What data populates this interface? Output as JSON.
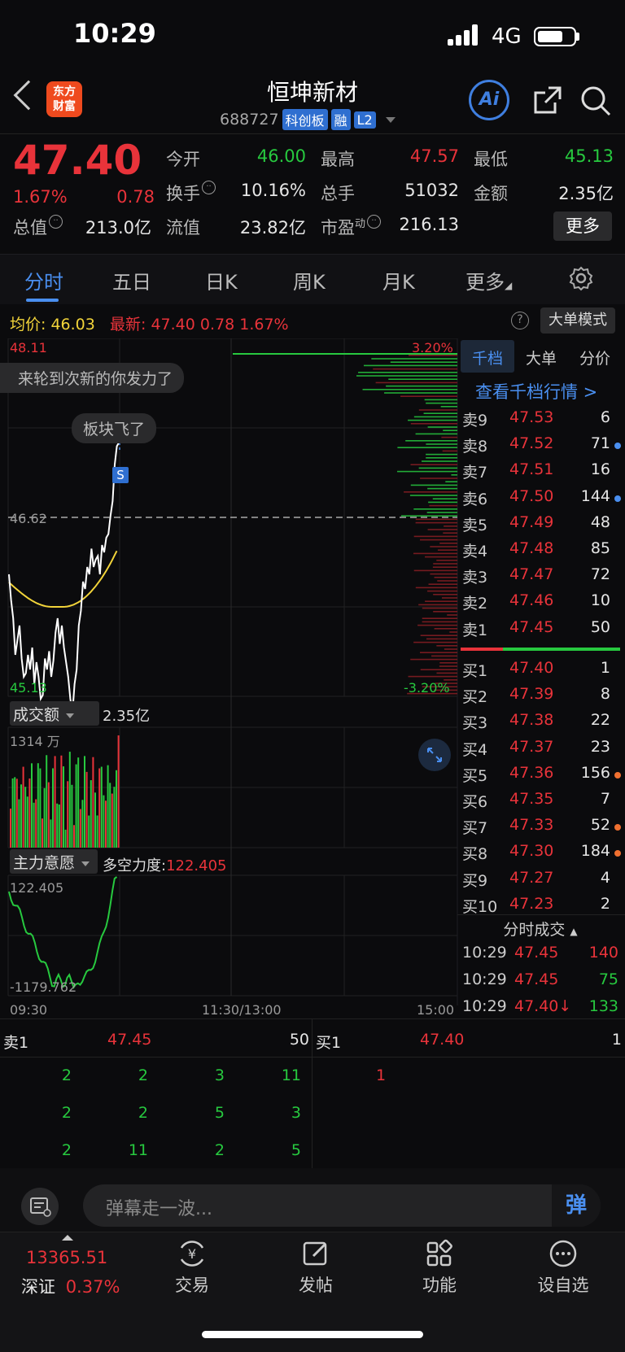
{
  "status_bar": {
    "time": "10:29",
    "network": "4G"
  },
  "header": {
    "logo_line1": "东方",
    "logo_line2": "财富",
    "stock_name": "恒坤新材",
    "stock_code": "688727",
    "tags": [
      "科创板",
      "融",
      "L2"
    ],
    "ai_label": "Ai"
  },
  "quote": {
    "last_price": "47.40",
    "change_pct": "1.67%",
    "change_amt": "0.78",
    "open_label": "今开",
    "open_value": "46.00",
    "high_label": "最高",
    "high_value": "47.57",
    "low_label": "最低",
    "low_value": "45.13",
    "turnover_label": "换手",
    "turnover_value": "10.16%",
    "volume_label": "总手",
    "volume_value": "51032",
    "amount_label": "金额",
    "amount_value": "2.35亿",
    "mktcap_label": "总值",
    "mktcap_value": "213.0亿",
    "float_label": "流值",
    "float_value": "23.82亿",
    "pe_label": "市盈",
    "pe_sup": "动",
    "pe_value": "216.13",
    "more_label": "更多"
  },
  "tabs": [
    "分时",
    "五日",
    "日K",
    "周K",
    "月K",
    "更多"
  ],
  "avg_row": {
    "avg_label": "均价:",
    "avg_value": "46.03",
    "latest_label": "最新:",
    "latest_value": "47.40",
    "latest_chg": "0.78",
    "latest_pct": "1.67%",
    "help": "?",
    "bigorder_label": "大单模式"
  },
  "chart": {
    "price_high": "48.11",
    "price_low": "45.13",
    "pct_high": "3.20%",
    "pct_low": "-3.20%",
    "pre_close": "46.62",
    "bubble1": "来轮到次新的你发力了",
    "bubble2": "板块飞了",
    "marker": "S",
    "time_start": "09:30",
    "time_mid": "11:30/13:00",
    "time_end": "15:00",
    "colors": {
      "price_line": "#ffffff",
      "avg_line": "#f2d43a",
      "up": "#e8333a",
      "down": "#27c93f"
    }
  },
  "volume_panel": {
    "selector": "成交额",
    "value": "2.35亿",
    "max_label": "1314 万"
  },
  "strength_panel": {
    "selector": "主力意愿",
    "label": "多空力度:",
    "value": "122.405",
    "max_label": "122.405",
    "min_label": "-1179.762"
  },
  "order_book": {
    "tabs": [
      "千档",
      "大单",
      "分价"
    ],
    "thousand_link": "查看千档行情 >",
    "asks": [
      {
        "label": "卖9",
        "price": "47.53",
        "vol": "6",
        "dot": ""
      },
      {
        "label": "卖8",
        "price": "47.52",
        "vol": "71",
        "dot": "#4a8ff0"
      },
      {
        "label": "卖7",
        "price": "47.51",
        "vol": "16",
        "dot": ""
      },
      {
        "label": "卖6",
        "price": "47.50",
        "vol": "144",
        "dot": "#4a8ff0"
      },
      {
        "label": "卖5",
        "price": "47.49",
        "vol": "48",
        "dot": ""
      },
      {
        "label": "卖4",
        "price": "47.48",
        "vol": "85",
        "dot": ""
      },
      {
        "label": "卖3",
        "price": "47.47",
        "vol": "72",
        "dot": ""
      },
      {
        "label": "卖2",
        "price": "47.46",
        "vol": "10",
        "dot": ""
      },
      {
        "label": "卖1",
        "price": "47.45",
        "vol": "50",
        "dot": ""
      }
    ],
    "bids": [
      {
        "label": "买1",
        "price": "47.40",
        "vol": "1",
        "dot": ""
      },
      {
        "label": "买2",
        "price": "47.39",
        "vol": "8",
        "dot": ""
      },
      {
        "label": "买3",
        "price": "47.38",
        "vol": "22",
        "dot": ""
      },
      {
        "label": "买4",
        "price": "47.37",
        "vol": "23",
        "dot": ""
      },
      {
        "label": "买5",
        "price": "47.36",
        "vol": "156",
        "dot": "#f07030"
      },
      {
        "label": "买6",
        "price": "47.35",
        "vol": "7",
        "dot": ""
      },
      {
        "label": "买7",
        "price": "47.33",
        "vol": "52",
        "dot": "#f07030"
      },
      {
        "label": "买8",
        "price": "47.30",
        "vol": "184",
        "dot": "#f07030"
      },
      {
        "label": "买9",
        "price": "47.27",
        "vol": "4",
        "dot": ""
      },
      {
        "label": "买10",
        "price": "47.23",
        "vol": "2",
        "dot": ""
      }
    ],
    "trades_title": "分时成交",
    "trades": [
      {
        "time": "10:29",
        "price": "47.45",
        "vol": "140",
        "color": "#e8333a"
      },
      {
        "time": "10:29",
        "price": "47.45",
        "vol": "75",
        "color": "#27c93f"
      },
      {
        "time": "10:29",
        "price": "47.40↓",
        "vol": "133",
        "color": "#27c93f"
      }
    ]
  },
  "level_queue": {
    "ask_label": "卖1",
    "ask_price": "47.45",
    "ask_vol": "50",
    "bid_label": "买1",
    "bid_price": "47.40",
    "bid_vol": "1",
    "ask_queue": [
      [
        "2",
        "2",
        "3",
        "11"
      ],
      [
        "2",
        "2",
        "5",
        "3"
      ],
      [
        "2",
        "11",
        "2",
        "5"
      ]
    ],
    "bid_queue": [
      "1"
    ]
  },
  "danmu": {
    "placeholder": "弹幕走一波...",
    "send": "弹"
  },
  "bottom_nav": {
    "index_value": "13365.51",
    "index_name": "深证",
    "index_pct": "0.37%",
    "items": [
      "交易",
      "发帖",
      "功能",
      "设自选"
    ]
  }
}
